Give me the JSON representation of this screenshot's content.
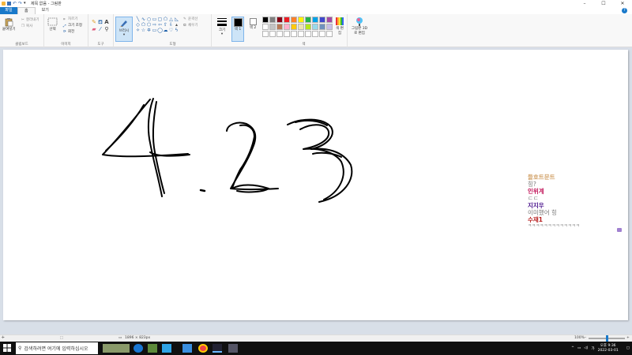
{
  "window": {
    "title": "제목 없음 - 그림판",
    "controls": [
      "minimize",
      "maximize",
      "close"
    ]
  },
  "tabs": {
    "file": "파일",
    "home": "홈",
    "view": "보기"
  },
  "ribbon": {
    "clipboard": {
      "label": "클립보드",
      "paste": "붙여넣기",
      "cut": "잘라내기",
      "copy": "복사"
    },
    "image": {
      "label": "이미지",
      "select": "선택",
      "crop": "자르기",
      "resize": "크기 조정",
      "rotate": "회전"
    },
    "tools": {
      "label": "도구"
    },
    "brush": "브러시",
    "shapes": {
      "label": "도형",
      "outline": "윤곽선",
      "fill": "채우기"
    },
    "size": "크기",
    "color1": "색 1",
    "color2": "색 2",
    "colors": {
      "label": "색",
      "edit": "색 편집",
      "paint3d": "그림판 3D로 편집"
    },
    "palette_colors": [
      "#000000",
      "#7f7f7f",
      "#880015",
      "#ed1c24",
      "#ff7f27",
      "#fff200",
      "#22b14c",
      "#00a2e8",
      "#3f48cc",
      "#a349a4",
      "#ffffff",
      "#c3c3c3",
      "#b97a57",
      "#ffaec9",
      "#ffc90e",
      "#efe4b0",
      "#b5e61d",
      "#99d9ea",
      "#7092be",
      "#c8bfe7",
      "#ffffff",
      "#ffffff",
      "#ffffff",
      "#ffffff",
      "#ffffff",
      "#ffffff",
      "#ffffff",
      "#ffffff",
      "#ffffff",
      "#ffffff"
    ]
  },
  "canvas": {
    "drawing": "4.23"
  },
  "chat": [
    {
      "name": "들호트문트",
      "message": "힝?"
    },
    {
      "name": "인위계",
      "message": "ㄷㄷ"
    },
    {
      "name": "지지우",
      "message": "이미했어 힝"
    },
    {
      "name": "수재1",
      "message": "ㅋㅋㅋㅋㅋㅋㅋㅋㅋㅋㅋㅋㅋ"
    }
  ],
  "status": {
    "dimensions": "1896 × 823px",
    "zoom": "100%"
  },
  "taskbar": {
    "search_placeholder": "검색하려면 여기에 입력하십시오",
    "time": "오후 9:36",
    "date": "2022-03-01"
  }
}
